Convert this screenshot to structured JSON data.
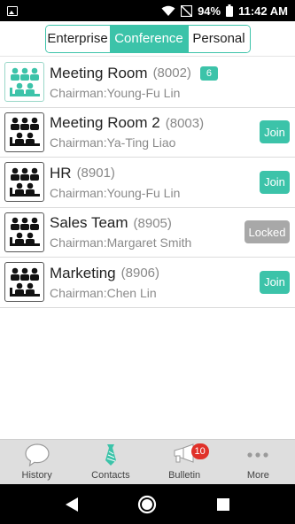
{
  "status_bar": {
    "battery": "94%",
    "time": "11:42 AM"
  },
  "tabs": [
    {
      "label": "Enterprise",
      "active": false
    },
    {
      "label": "Conference",
      "active": true
    },
    {
      "label": "Personal",
      "active": false
    }
  ],
  "rooms": [
    {
      "name": "Meeting Room",
      "number": "(8002)",
      "chairman": "Chairman:Young-Fu Lin",
      "count": "6",
      "action": ""
    },
    {
      "name": "Meeting Room 2",
      "number": "(8003)",
      "chairman": "Chairman:Ya-Ting Liao",
      "action": "Join"
    },
    {
      "name": "HR",
      "number": "(8901)",
      "chairman": "Chairman:Young-Fu Lin",
      "action": "Join"
    },
    {
      "name": "Sales Team",
      "number": "(8905)",
      "chairman": "Chairman:Margaret Smith",
      "action": "Locked"
    },
    {
      "name": "Marketing",
      "number": "(8906)",
      "chairman": "Chairman:Chen Lin",
      "action": "Join"
    }
  ],
  "bottom_nav": [
    {
      "label": "History",
      "icon": "speech-bubble-icon"
    },
    {
      "label": "Contacts",
      "icon": "tie-icon"
    },
    {
      "label": "Bulletin",
      "icon": "megaphone-icon",
      "badge": "10"
    },
    {
      "label": "More",
      "icon": "more-dots-icon"
    }
  ],
  "colors": {
    "accent": "#3cc3a9",
    "locked": "#a8a8a8",
    "badge": "#e0312a"
  }
}
